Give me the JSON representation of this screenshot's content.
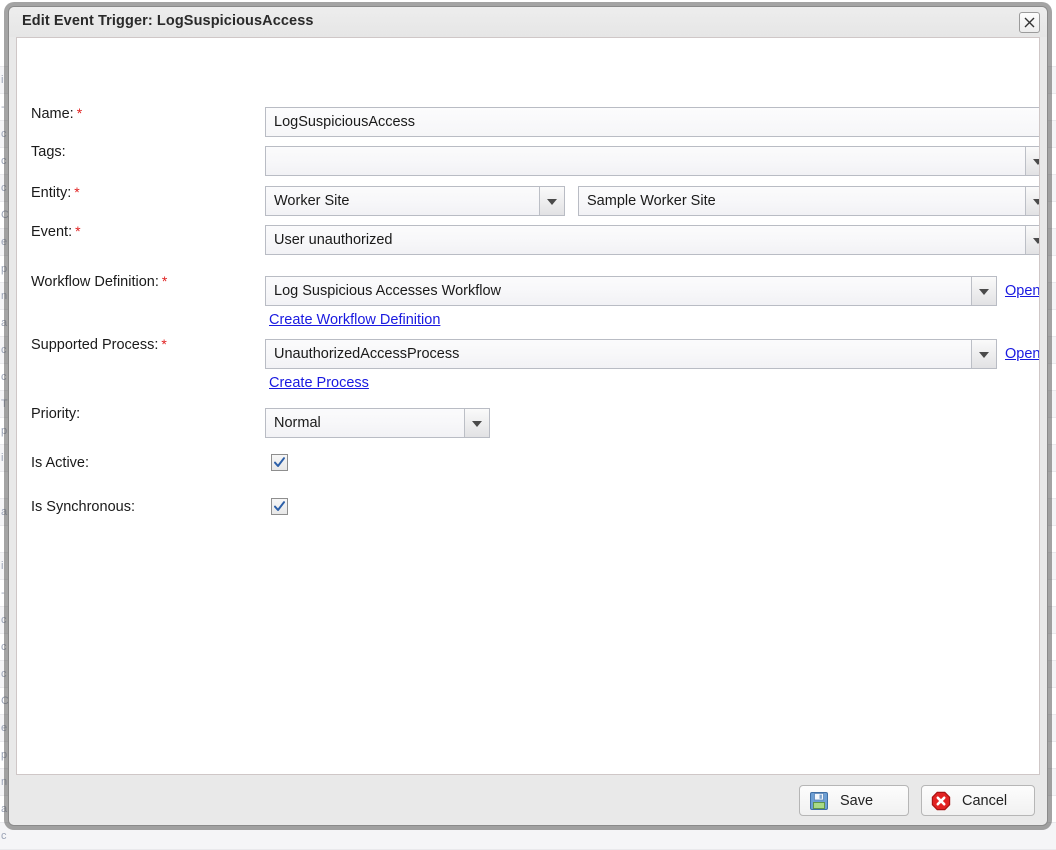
{
  "dialog": {
    "title": "Edit Event Trigger: LogSuspiciousAccess",
    "close_icon": "close-x-icon"
  },
  "form": {
    "fields": [
      {
        "label": "Name:",
        "required": true,
        "value": "LogSuspiciousAccess"
      },
      {
        "label": "Tags:",
        "required": false,
        "value": ""
      },
      {
        "label": "Entity:",
        "required": true,
        "value": "Worker Site",
        "value2": "Sample Worker Site"
      },
      {
        "label": "Event:",
        "required": true,
        "value": "User unauthorized"
      },
      {
        "label": "Workflow Definition:",
        "required": true,
        "value": "Log Suspicious Accesses Workflow",
        "open_link": "Open",
        "create_link": "Create Workflow Definition"
      },
      {
        "label": "Supported Process:",
        "required": true,
        "value": "UnauthorizedAccessProcess",
        "open_link": "Open",
        "create_link": "Create Process"
      },
      {
        "label": "Priority:",
        "required": false,
        "value": "Normal"
      },
      {
        "label": "Is Active:",
        "required": false,
        "checked": true
      },
      {
        "label": "Is Synchronous:",
        "required": false,
        "checked": true
      }
    ]
  },
  "footer": {
    "save_label": "Save",
    "cancel_label": "Cancel",
    "save_icon": "floppy-disk-icon",
    "cancel_icon": "red-octagon-x-icon"
  },
  "colors": {
    "link": "#1a1ae0",
    "required_asterisk": "#e02020",
    "dialog_chrome": "#e9e9e9",
    "save_icon_blue": "#5b8fc9",
    "save_icon_green": "#9bd37a",
    "cancel_icon_red": "#e01b1b"
  },
  "background": {
    "row_text": [
      "",
      "i",
      "-",
      "c",
      "c",
      "c",
      "C",
      "e",
      "p",
      "n",
      "a",
      "c",
      "c",
      "T",
      "p",
      "i",
      "",
      "a"
    ]
  }
}
